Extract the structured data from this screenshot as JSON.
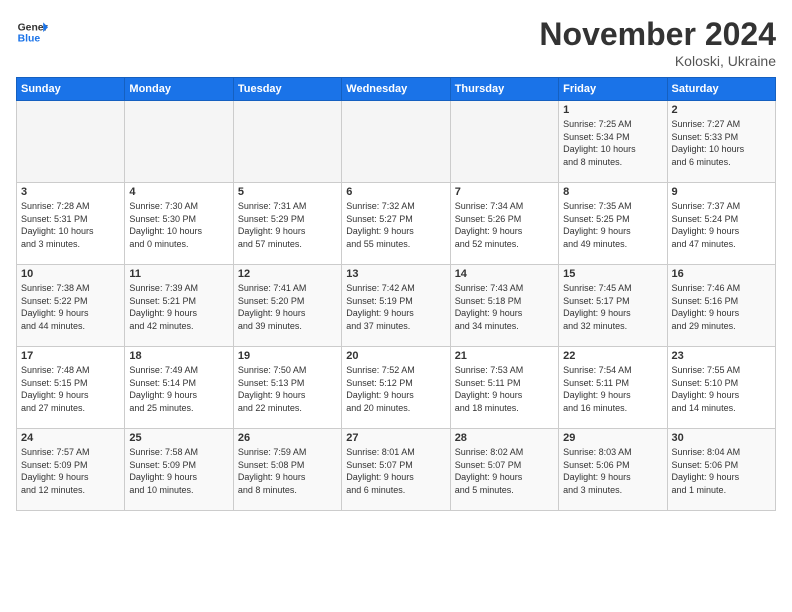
{
  "header": {
    "logo_general": "General",
    "logo_blue": "Blue",
    "title": "November 2024",
    "location": "Koloski, Ukraine"
  },
  "weekdays": [
    "Sunday",
    "Monday",
    "Tuesday",
    "Wednesday",
    "Thursday",
    "Friday",
    "Saturday"
  ],
  "weeks": [
    [
      {
        "day": "",
        "info": ""
      },
      {
        "day": "",
        "info": ""
      },
      {
        "day": "",
        "info": ""
      },
      {
        "day": "",
        "info": ""
      },
      {
        "day": "",
        "info": ""
      },
      {
        "day": "1",
        "info": "Sunrise: 7:25 AM\nSunset: 5:34 PM\nDaylight: 10 hours\nand 8 minutes."
      },
      {
        "day": "2",
        "info": "Sunrise: 7:27 AM\nSunset: 5:33 PM\nDaylight: 10 hours\nand 6 minutes."
      }
    ],
    [
      {
        "day": "3",
        "info": "Sunrise: 7:28 AM\nSunset: 5:31 PM\nDaylight: 10 hours\nand 3 minutes."
      },
      {
        "day": "4",
        "info": "Sunrise: 7:30 AM\nSunset: 5:30 PM\nDaylight: 10 hours\nand 0 minutes."
      },
      {
        "day": "5",
        "info": "Sunrise: 7:31 AM\nSunset: 5:29 PM\nDaylight: 9 hours\nand 57 minutes."
      },
      {
        "day": "6",
        "info": "Sunrise: 7:32 AM\nSunset: 5:27 PM\nDaylight: 9 hours\nand 55 minutes."
      },
      {
        "day": "7",
        "info": "Sunrise: 7:34 AM\nSunset: 5:26 PM\nDaylight: 9 hours\nand 52 minutes."
      },
      {
        "day": "8",
        "info": "Sunrise: 7:35 AM\nSunset: 5:25 PM\nDaylight: 9 hours\nand 49 minutes."
      },
      {
        "day": "9",
        "info": "Sunrise: 7:37 AM\nSunset: 5:24 PM\nDaylight: 9 hours\nand 47 minutes."
      }
    ],
    [
      {
        "day": "10",
        "info": "Sunrise: 7:38 AM\nSunset: 5:22 PM\nDaylight: 9 hours\nand 44 minutes."
      },
      {
        "day": "11",
        "info": "Sunrise: 7:39 AM\nSunset: 5:21 PM\nDaylight: 9 hours\nand 42 minutes."
      },
      {
        "day": "12",
        "info": "Sunrise: 7:41 AM\nSunset: 5:20 PM\nDaylight: 9 hours\nand 39 minutes."
      },
      {
        "day": "13",
        "info": "Sunrise: 7:42 AM\nSunset: 5:19 PM\nDaylight: 9 hours\nand 37 minutes."
      },
      {
        "day": "14",
        "info": "Sunrise: 7:43 AM\nSunset: 5:18 PM\nDaylight: 9 hours\nand 34 minutes."
      },
      {
        "day": "15",
        "info": "Sunrise: 7:45 AM\nSunset: 5:17 PM\nDaylight: 9 hours\nand 32 minutes."
      },
      {
        "day": "16",
        "info": "Sunrise: 7:46 AM\nSunset: 5:16 PM\nDaylight: 9 hours\nand 29 minutes."
      }
    ],
    [
      {
        "day": "17",
        "info": "Sunrise: 7:48 AM\nSunset: 5:15 PM\nDaylight: 9 hours\nand 27 minutes."
      },
      {
        "day": "18",
        "info": "Sunrise: 7:49 AM\nSunset: 5:14 PM\nDaylight: 9 hours\nand 25 minutes."
      },
      {
        "day": "19",
        "info": "Sunrise: 7:50 AM\nSunset: 5:13 PM\nDaylight: 9 hours\nand 22 minutes."
      },
      {
        "day": "20",
        "info": "Sunrise: 7:52 AM\nSunset: 5:12 PM\nDaylight: 9 hours\nand 20 minutes."
      },
      {
        "day": "21",
        "info": "Sunrise: 7:53 AM\nSunset: 5:11 PM\nDaylight: 9 hours\nand 18 minutes."
      },
      {
        "day": "22",
        "info": "Sunrise: 7:54 AM\nSunset: 5:11 PM\nDaylight: 9 hours\nand 16 minutes."
      },
      {
        "day": "23",
        "info": "Sunrise: 7:55 AM\nSunset: 5:10 PM\nDaylight: 9 hours\nand 14 minutes."
      }
    ],
    [
      {
        "day": "24",
        "info": "Sunrise: 7:57 AM\nSunset: 5:09 PM\nDaylight: 9 hours\nand 12 minutes."
      },
      {
        "day": "25",
        "info": "Sunrise: 7:58 AM\nSunset: 5:09 PM\nDaylight: 9 hours\nand 10 minutes."
      },
      {
        "day": "26",
        "info": "Sunrise: 7:59 AM\nSunset: 5:08 PM\nDaylight: 9 hours\nand 8 minutes."
      },
      {
        "day": "27",
        "info": "Sunrise: 8:01 AM\nSunset: 5:07 PM\nDaylight: 9 hours\nand 6 minutes."
      },
      {
        "day": "28",
        "info": "Sunrise: 8:02 AM\nSunset: 5:07 PM\nDaylight: 9 hours\nand 5 minutes."
      },
      {
        "day": "29",
        "info": "Sunrise: 8:03 AM\nSunset: 5:06 PM\nDaylight: 9 hours\nand 3 minutes."
      },
      {
        "day": "30",
        "info": "Sunrise: 8:04 AM\nSunset: 5:06 PM\nDaylight: 9 hours\nand 1 minute."
      }
    ]
  ]
}
